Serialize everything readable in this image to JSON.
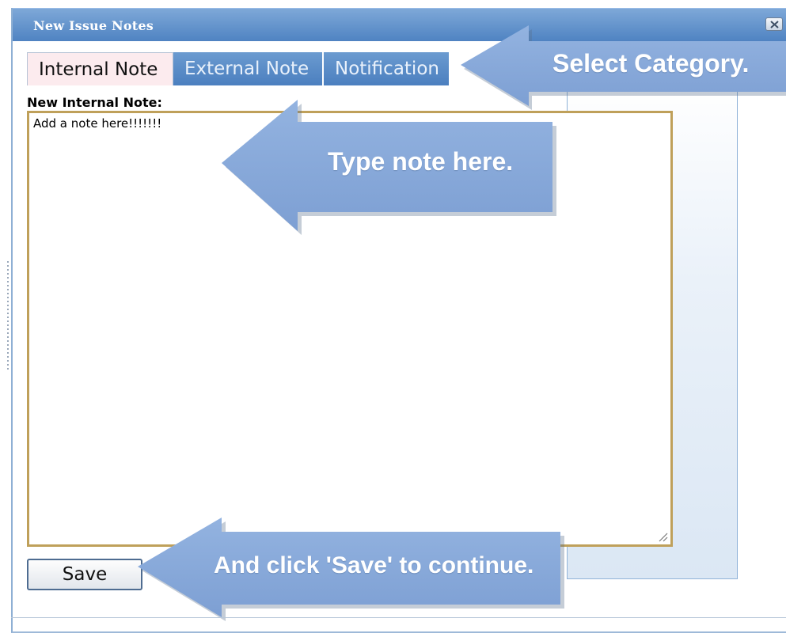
{
  "dialog": {
    "title": "New Issue Notes",
    "close_icon": "close-icon"
  },
  "tabs": [
    {
      "label": "Internal Note",
      "active": true
    },
    {
      "label": "External Note",
      "active": false
    },
    {
      "label": "Notification",
      "active": false
    }
  ],
  "form": {
    "section_label": "New Internal Note:",
    "note_value": "Add a note here!!!!!!!",
    "save_label": "Save"
  },
  "callouts": {
    "select_category": "Select Category.",
    "type_note": "Type note here.",
    "click_save": "And click 'Save' to continue."
  },
  "colors": {
    "titlebar": "#5b8cc8",
    "callout_fill": "#86a9dc",
    "active_tab": "#fcebee",
    "inactive_tab": "#5a8cc8",
    "textarea_border": "#bfa05a"
  }
}
